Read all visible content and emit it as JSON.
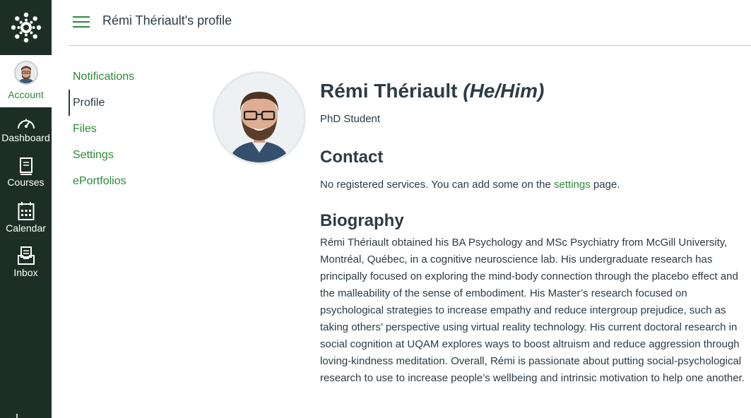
{
  "global_nav": {
    "account_label": "Account",
    "items": [
      {
        "label": "Dashboard",
        "icon": "dashboard-icon"
      },
      {
        "label": "Courses",
        "icon": "courses-icon"
      },
      {
        "label": "Calendar",
        "icon": "calendar-icon"
      },
      {
        "label": "Inbox",
        "icon": "inbox-icon"
      }
    ]
  },
  "header": {
    "title": "Rémi Thériault's profile"
  },
  "section_nav": {
    "notifications": "Notifications",
    "profile": "Profile",
    "files": "Files",
    "settings": "Settings",
    "eportfolios": "ePortfolios"
  },
  "profile": {
    "name": "Rémi Thériault",
    "pronouns": "(He/Him)",
    "title": "PhD Student",
    "contact_heading": "Contact",
    "contact_text_before": "No registered services. You can add some on the ",
    "contact_link": "settings",
    "contact_text_after": " page.",
    "bio_heading": "Biography",
    "bio": "Rémi Thériault obtained his BA Psychology and MSc Psychiatry from McGill University, Montréal, Québec, in a cognitive neuroscience lab. His undergraduate research has principally focused on exploring the mind-body connection through the placebo effect and the malleability of the sense of embodiment. His Master’s research focused on psychological strategies to increase empathy and reduce intergroup prejudice, such as taking others’ perspective using virtual reality technology. His current doctoral research in social cognition at UQAM explores ways to boost altruism and reduce aggression through loving-kindness meditation. Overall, Rémi is passionate about putting social-psychological research to use to increase people’s wellbeing and intrinsic motivation to help one another."
  },
  "colors": {
    "nav_bg": "#1d2e26",
    "accent": "#2e8a36",
    "text": "#2d3b45",
    "divider": "#c7cdd1"
  }
}
